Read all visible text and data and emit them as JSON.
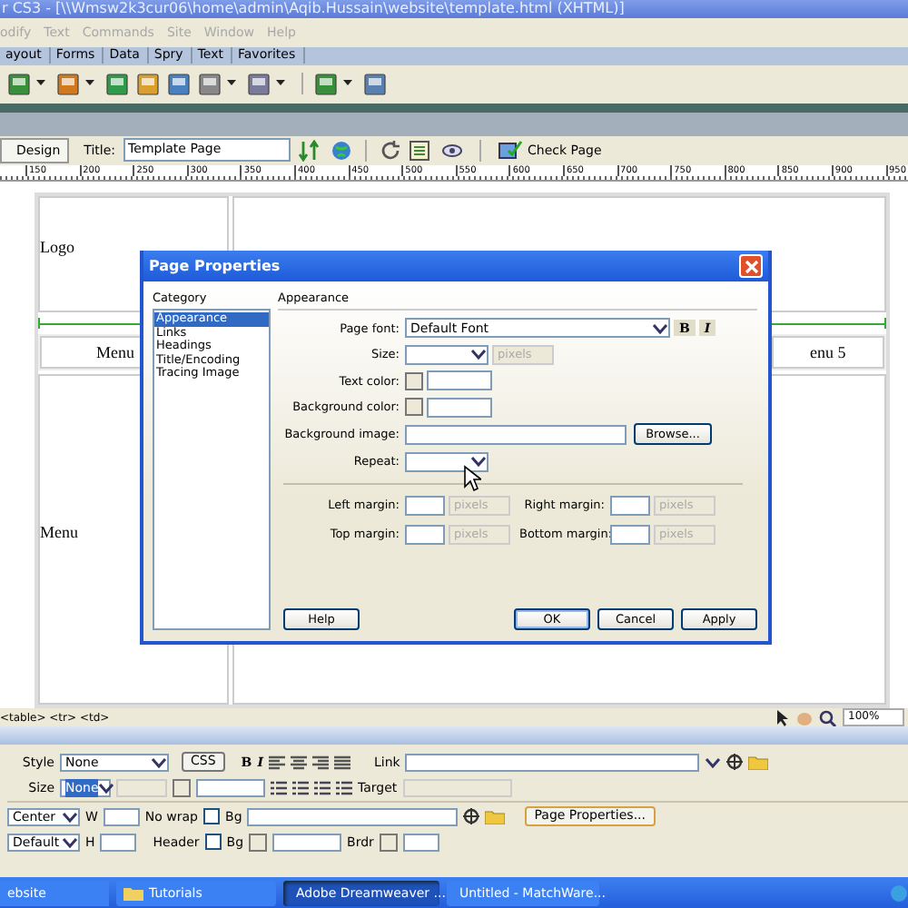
{
  "window": {
    "title": "r CS3 - [\\\\Wmsw2k3cur06\\home\\admin\\Aqib.Hussain\\website\\template.html (XHTML)]"
  },
  "menu_bar": [
    "odify",
    "Text",
    "Commands",
    "Site",
    "Window",
    "Help"
  ],
  "insert_tabs": [
    "ayout",
    "Forms",
    "Data",
    "Spry",
    "Text",
    "Favorites"
  ],
  "document_toolbar": {
    "view_button": "Design",
    "title_label": "Title:",
    "title_value": "Template Page",
    "check_page": "Check Page"
  },
  "ruler": [
    "150",
    "200",
    "250",
    "300",
    "350",
    "400",
    "450",
    "500",
    "550",
    "600",
    "650",
    "700",
    "750",
    "800",
    "850",
    "900",
    "950"
  ],
  "canvas": {
    "logo": "Logo",
    "menu_left": "Menu",
    "menu_right": "enu 5",
    "side_text": "Menu"
  },
  "dialog": {
    "title": "Page Properties",
    "category_label": "Category",
    "categories": [
      {
        "label": "Appearance",
        "selected": true
      },
      {
        "label": "Links",
        "selected": false
      },
      {
        "label": "Headings",
        "selected": false
      },
      {
        "label": "Title/Encoding",
        "selected": false
      },
      {
        "label": "Tracing Image",
        "selected": false
      }
    ],
    "section": "Appearance",
    "page_font": {
      "label": "Page font:",
      "value": "Default Font",
      "bold": "B",
      "italic": "I"
    },
    "size": {
      "label": "Size:",
      "unit": "pixels",
      "unit_disabled": true
    },
    "text_color": {
      "label": "Text color:"
    },
    "background_color": {
      "label": "Background color:"
    },
    "background_image": {
      "label": "Background image:",
      "button": "Browse..."
    },
    "repeat": {
      "label": "Repeat:"
    },
    "margins": [
      {
        "label": "Left margin:",
        "unit": "pixels",
        "unit_disabled": true
      },
      {
        "label": "Right margin:",
        "unit": "pixels",
        "unit_disabled": true
      },
      {
        "label": "Top margin:",
        "unit": "pixels",
        "unit_disabled": true
      },
      {
        "label": "Bottom margin:",
        "unit": "pixels",
        "unit_disabled": true
      }
    ],
    "buttons": [
      {
        "label": "Help",
        "focused": false
      },
      {
        "label": "OK",
        "focused": true
      },
      {
        "label": "Cancel",
        "focused": false
      },
      {
        "label": "Apply",
        "focused": false
      }
    ]
  },
  "status_bar": {
    "tags": "<table> <tr> <td>",
    "zoom": "100%"
  },
  "properties": {
    "style_label": "Style",
    "style_value": "None",
    "css_button": "CSS",
    "bold": "B",
    "italic": "I",
    "link_label": "Link",
    "size_label": "Size",
    "size_value": "None",
    "target_label": "Target",
    "horz_value": "Center",
    "w_label": "W",
    "nowrap_label": "No wrap",
    "nowrap_checked": false,
    "bg_label": "Bg",
    "page_properties_button": "Page Properties...",
    "vert_value": "Default",
    "h_label": "H",
    "header_label": "Header",
    "header_checked": false,
    "bg2_label": "Bg",
    "brdr_label": "Brdr"
  },
  "taskbar": [
    {
      "label": "ebsite",
      "selected": false
    },
    {
      "label": "Tutorials",
      "selected": false
    },
    {
      "label": "Adobe Dreamweaver ...",
      "selected": true
    },
    {
      "label": "Untitled - MatchWare...",
      "selected": false
    }
  ]
}
